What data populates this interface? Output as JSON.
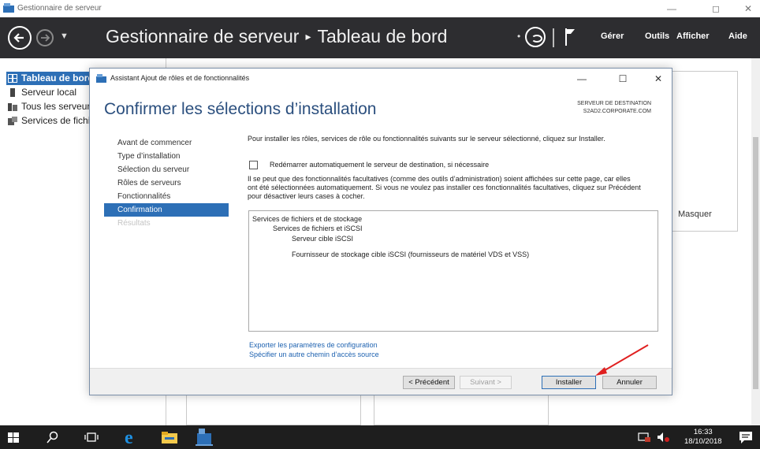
{
  "outer_window": {
    "title": "Gestionnaire de serveur",
    "minimize": "—",
    "maximize": "◻",
    "close": "✕"
  },
  "header": {
    "app_name": "Gestionnaire de serveur",
    "separator": "▸",
    "section": "Tableau de bord",
    "menu": {
      "manage": "Gérer",
      "tools": "Outils",
      "view": "Afficher",
      "help": "Aide"
    }
  },
  "sidebar": {
    "items": [
      {
        "label": "Tableau de bord",
        "icon": "dashboard-icon",
        "active": true
      },
      {
        "label": "Serveur local",
        "icon": "server-icon",
        "active": false
      },
      {
        "label": "Tous les serveurs",
        "icon": "servers-icon",
        "active": false
      },
      {
        "label": "Services de fichiers et de stockage",
        "icon": "file-services-icon",
        "active": false
      }
    ]
  },
  "background": {
    "hide_label": "Masquer"
  },
  "wizard": {
    "title": "Assistant Ajout de rôles et de fonctionnalités",
    "heading": "Confirmer les sélections d’installation",
    "destination_label": "SERVEUR DE DESTINATION",
    "destination_server": "S2AD2.CORPORATE.COM",
    "steps": [
      {
        "label": "Avant de commencer",
        "state": "normal"
      },
      {
        "label": "Type d’installation",
        "state": "normal"
      },
      {
        "label": "Sélection du serveur",
        "state": "normal"
      },
      {
        "label": "Rôles de serveurs",
        "state": "normal"
      },
      {
        "label": "Fonctionnalités",
        "state": "normal"
      },
      {
        "label": "Confirmation",
        "state": "active"
      },
      {
        "label": "Résultats",
        "state": "disabled"
      }
    ],
    "intro": "Pour installer les rôles, services de rôle ou fonctionnalités suivants sur le serveur sélectionné, cliquez sur Installer.",
    "restart_checkbox": {
      "label": "Redémarrer automatiquement le serveur de destination, si nécessaire",
      "checked": false
    },
    "note": "Il se peut que des fonctionnalités facultatives (comme des outils d’administration) soient affichées sur cette page, car elles ont été sélectionnées automatiquement. Si vous ne voulez pas installer ces fonctionnalités facultatives, cliquez sur Précédent pour désactiver leurs cases à cocher.",
    "features": [
      {
        "label": "Services de fichiers et de stockage",
        "level": 0
      },
      {
        "label": "Services de fichiers et iSCSI",
        "level": 1
      },
      {
        "label": "Serveur cible iSCSI",
        "level": 2
      },
      {
        "label": "Fournisseur de stockage cible iSCSI (fournisseurs de matériel VDS et VSS)",
        "level": 2
      }
    ],
    "links": {
      "export": "Exporter les paramètres de configuration",
      "alternate_source": "Spécifier un autre chemin d’accès source"
    },
    "buttons": {
      "previous": "< Précédent",
      "next": "Suivant >",
      "install": "Installer",
      "cancel": "Annuler"
    }
  },
  "taskbar": {
    "time": "16:33",
    "date": "18/10/2018"
  },
  "colors": {
    "header_bg": "#2d2d30",
    "accent": "#2d6fb6",
    "heading": "#2b4f7e",
    "link": "#1e62b0",
    "annotation_arrow": "#e02020"
  }
}
